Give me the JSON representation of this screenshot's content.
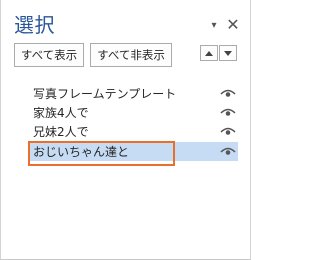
{
  "pane": {
    "title": "選択",
    "menu_icon": "dropdown-arrow-icon",
    "close_icon": "close-icon"
  },
  "toolbar": {
    "show_all_label": "すべて表示",
    "hide_all_label": "すべて非表示",
    "bring_forward_icon": "triangle-up-icon",
    "send_backward_icon": "triangle-down-icon"
  },
  "objects": [
    {
      "label": "写真フレームテンプレート",
      "visible": true,
      "selected": false
    },
    {
      "label": "家族4人で",
      "visible": true,
      "selected": false
    },
    {
      "label": "兄妹2人で",
      "visible": true,
      "selected": false
    },
    {
      "label": "おじいちゃん達と",
      "visible": true,
      "selected": true
    }
  ],
  "colors": {
    "title": "#2b579a",
    "selection_fill": "#c6dcf4",
    "highlight_border": "#e8702a"
  }
}
